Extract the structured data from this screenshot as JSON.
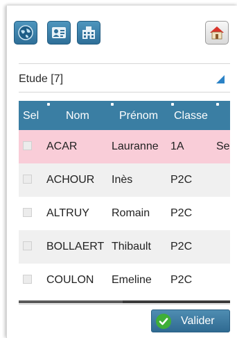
{
  "toolbar": {
    "buttons": [
      {
        "name": "globe-icon"
      },
      {
        "name": "contact-card-icon"
      },
      {
        "name": "building-icon"
      },
      {
        "name": "home-icon"
      }
    ]
  },
  "filter": {
    "selected": "Etude [7]"
  },
  "table": {
    "columns": [
      "Sel",
      "Nom",
      "Prénom",
      "Classe"
    ],
    "rows": [
      {
        "nom": "ACAR",
        "prenom": "Lauranne",
        "classe": "1A",
        "extra": "Se",
        "highlighted": true
      },
      {
        "nom": "ACHOUR",
        "prenom": "Inès",
        "classe": "P2C",
        "extra": ""
      },
      {
        "nom": "ALTRUY",
        "prenom": "Romain",
        "classe": "P2C",
        "extra": ""
      },
      {
        "nom": "BOLLAERT",
        "prenom": "Thibault",
        "classe": "P2C",
        "extra": ""
      },
      {
        "nom": "COULON",
        "prenom": "Emeline",
        "classe": "P2C",
        "extra": ""
      }
    ]
  },
  "colors": {
    "header_bg": "#3a7ea3",
    "highlight_row": "#f9cdd8",
    "alt_row": "#f0f0f0",
    "accent": "#2b82c6"
  },
  "actions": {
    "validate_label": "Valider"
  }
}
